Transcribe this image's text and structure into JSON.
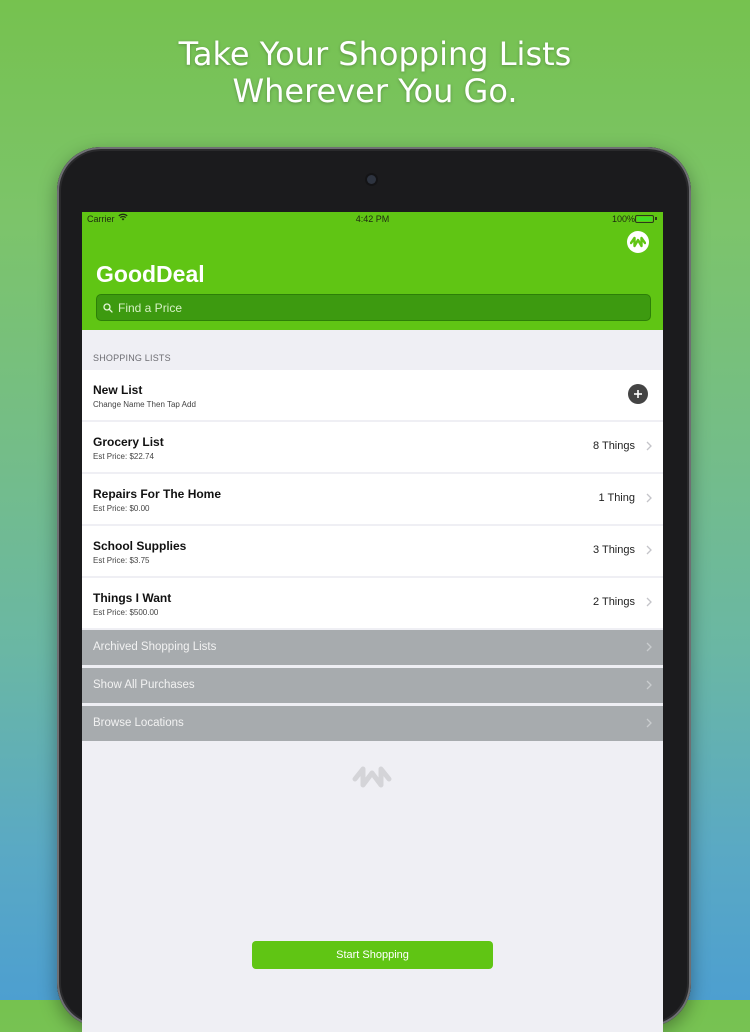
{
  "headline": {
    "line1": "Take Your Shopping Lists",
    "line2": "Wherever You Go."
  },
  "status_bar": {
    "carrier": "Carrier",
    "time": "4:42 PM",
    "battery": "100%"
  },
  "app": {
    "title": "GoodDeal",
    "search_placeholder": "Find a Price",
    "accent_color": "#60c514"
  },
  "shopping_lists": {
    "section_label": "SHOPPING LISTS",
    "new_list": {
      "title": "New List",
      "subtitle": "Change Name Then Tap Add"
    },
    "lists": [
      {
        "name": "Grocery List",
        "price": "Est Price: $22.74",
        "count": "8 Things"
      },
      {
        "name": "Repairs For The Home",
        "price": "Est Price: $0.00",
        "count": "1 Thing"
      },
      {
        "name": "School Supplies",
        "price": "Est Price: $3.75",
        "count": "3 Things"
      },
      {
        "name": "Things I Want",
        "price": "Est Price: $500.00",
        "count": "2 Things"
      }
    ]
  },
  "menu": [
    {
      "label": "Archived Shopping Lists"
    },
    {
      "label": "Show All Purchases"
    },
    {
      "label": "Browse Locations"
    }
  ],
  "start_button": "Start Shopping",
  "icons": {
    "header": "app-logo-icon",
    "search": "search-icon",
    "add": "plus-icon",
    "row": "chevron-right-icon",
    "footer": "app-logo-icon",
    "wifi": "wifi-icon",
    "battery": "battery-icon"
  }
}
